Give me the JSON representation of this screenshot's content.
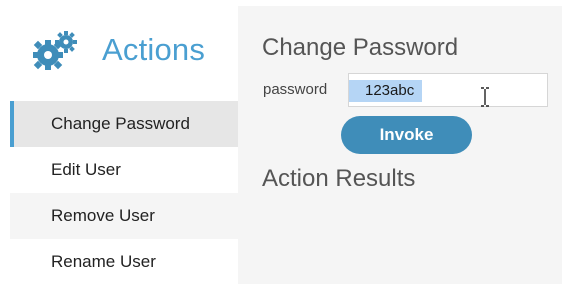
{
  "sidebar": {
    "title": "Actions",
    "icon": "gears-icon",
    "accent_color": "#4a9fd1",
    "items": [
      {
        "label": "Change Password",
        "active": true
      },
      {
        "label": "Edit User",
        "active": false
      },
      {
        "label": "Remove User",
        "active": false
      },
      {
        "label": "Rename User",
        "active": false
      }
    ]
  },
  "main": {
    "title": "Change Password",
    "field_label": "password",
    "password_value": "123abc",
    "invoke_label": "Invoke",
    "button_color": "#3f8db9",
    "results_title": "Action Results"
  }
}
